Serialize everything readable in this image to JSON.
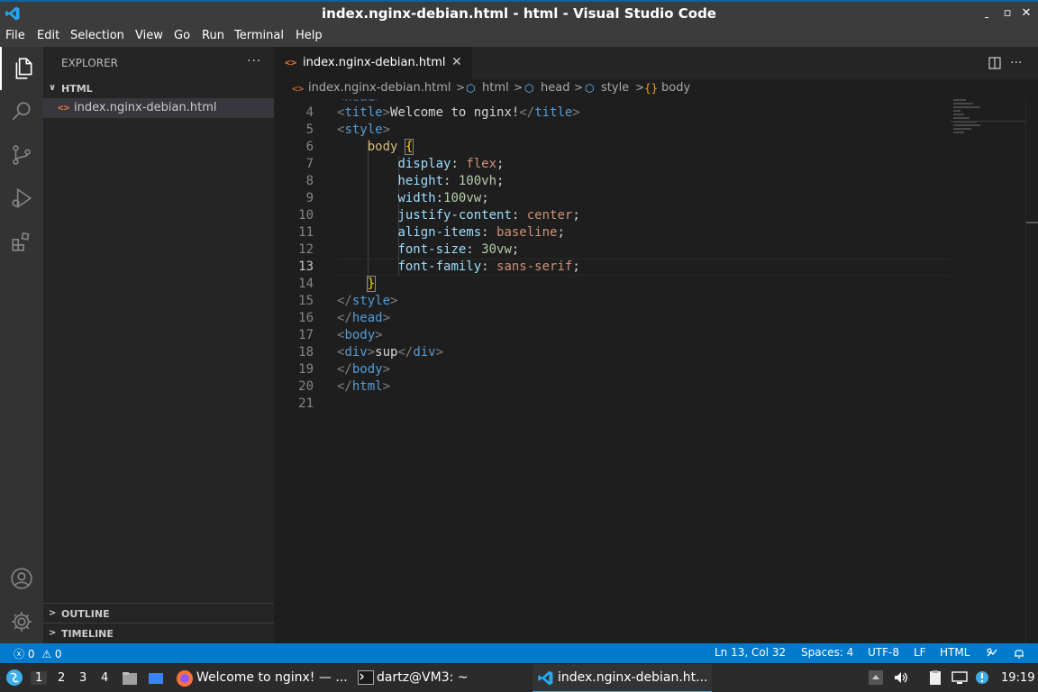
{
  "window": {
    "title": "index.nginx-debian.html - html - Visual Studio Code",
    "controls": {
      "minimize": "ˍ",
      "maximize": "▫",
      "close": "✕"
    }
  },
  "menu": [
    "File",
    "Edit",
    "Selection",
    "View",
    "Go",
    "Run",
    "Terminal",
    "Help"
  ],
  "activity_bar": {
    "top": [
      "explorer-icon",
      "search-icon",
      "source-control-icon",
      "run-debug-icon",
      "extensions-icon"
    ],
    "bottom": [
      "accounts-icon",
      "manage-gear-icon"
    ]
  },
  "sidebar": {
    "title": "EXPLORER",
    "more": "···",
    "folder": {
      "chevron": "∨",
      "label": "HTML"
    },
    "files": [
      {
        "icon": "<>",
        "name": "index.nginx-debian.html"
      }
    ],
    "outline": {
      "chevron": ">",
      "label": "OUTLINE"
    },
    "timeline": {
      "chevron": ">",
      "label": "TIMELINE"
    }
  },
  "tab": {
    "icon": "<>",
    "name": "index.nginx-debian.html",
    "close": "✕"
  },
  "breadcrumbs": [
    {
      "icon": "<>",
      "label": "index.nginx-debian.html"
    },
    {
      "icon": "⬡",
      "label": "html"
    },
    {
      "icon": "⬡",
      "label": "head"
    },
    {
      "icon": "⬡",
      "label": "style"
    },
    {
      "icon": "{}",
      "label": "body"
    }
  ],
  "breadcrumb_sep": ">",
  "code": {
    "current_line": "13",
    "partial_line": "<head>",
    "lines": [
      {
        "n": "4",
        "segs": [
          [
            "t-br",
            "<"
          ],
          [
            "t-tag",
            "title"
          ],
          [
            "t-br",
            ">"
          ],
          [
            "t-txt",
            "Welcome to nginx!"
          ],
          [
            "t-br",
            "</"
          ],
          [
            "t-tag",
            "title"
          ],
          [
            "t-br",
            ">"
          ]
        ]
      },
      {
        "n": "5",
        "segs": [
          [
            "t-br",
            "<"
          ],
          [
            "t-tag",
            "style"
          ],
          [
            "t-br",
            ">"
          ]
        ]
      },
      {
        "n": "6",
        "segs": [
          [
            "t-txt",
            "    "
          ],
          [
            "t-sel",
            "body"
          ],
          [
            "t-txt",
            " "
          ],
          [
            "t-brace brace-box",
            "{"
          ]
        ]
      },
      {
        "n": "7",
        "segs": [
          [
            "t-txt",
            "        "
          ],
          [
            "t-prop",
            "display"
          ],
          [
            "t-txt",
            ": "
          ],
          [
            "t-val",
            "flex"
          ],
          [
            "t-txt",
            ";"
          ]
        ]
      },
      {
        "n": "8",
        "segs": [
          [
            "t-txt",
            "        "
          ],
          [
            "t-prop",
            "height"
          ],
          [
            "t-txt",
            ": "
          ],
          [
            "t-num",
            "100vh"
          ],
          [
            "t-txt",
            ";"
          ]
        ]
      },
      {
        "n": "9",
        "segs": [
          [
            "t-txt",
            "        "
          ],
          [
            "t-prop",
            "width"
          ],
          [
            "t-txt",
            ":"
          ],
          [
            "t-num",
            "100vw"
          ],
          [
            "t-txt",
            ";"
          ]
        ]
      },
      {
        "n": "10",
        "segs": [
          [
            "t-txt",
            "        "
          ],
          [
            "t-prop",
            "justify-content"
          ],
          [
            "t-txt",
            ": "
          ],
          [
            "t-val",
            "center"
          ],
          [
            "t-txt",
            ";"
          ]
        ]
      },
      {
        "n": "11",
        "segs": [
          [
            "t-txt",
            "        "
          ],
          [
            "t-prop",
            "align-items"
          ],
          [
            "t-txt",
            ": "
          ],
          [
            "t-val",
            "baseline"
          ],
          [
            "t-txt",
            ";"
          ]
        ]
      },
      {
        "n": "12",
        "segs": [
          [
            "t-txt",
            "        "
          ],
          [
            "t-prop",
            "font-size"
          ],
          [
            "t-txt",
            ": "
          ],
          [
            "t-num",
            "30vw"
          ],
          [
            "t-txt",
            ";"
          ]
        ]
      },
      {
        "n": "13",
        "segs": [
          [
            "t-txt",
            "        "
          ],
          [
            "t-prop",
            "font-family"
          ],
          [
            "t-txt",
            ": "
          ],
          [
            "t-val",
            "sans-serif"
          ],
          [
            "t-txt",
            ";"
          ]
        ]
      },
      {
        "n": "14",
        "segs": [
          [
            "t-txt",
            "    "
          ],
          [
            "t-brace brace-box",
            "}"
          ]
        ]
      },
      {
        "n": "15",
        "segs": [
          [
            "t-br",
            "</"
          ],
          [
            "t-tag",
            "style"
          ],
          [
            "t-br",
            ">"
          ]
        ]
      },
      {
        "n": "16",
        "segs": [
          [
            "t-br",
            "</"
          ],
          [
            "t-tag",
            "head"
          ],
          [
            "t-br",
            ">"
          ]
        ]
      },
      {
        "n": "17",
        "segs": [
          [
            "t-br",
            "<"
          ],
          [
            "t-tag",
            "body"
          ],
          [
            "t-br",
            ">"
          ]
        ]
      },
      {
        "n": "18",
        "segs": [
          [
            "t-br",
            "<"
          ],
          [
            "t-tag",
            "div"
          ],
          [
            "t-br",
            ">"
          ],
          [
            "t-txt",
            "sup"
          ],
          [
            "t-br",
            "</"
          ],
          [
            "t-tag",
            "div"
          ],
          [
            "t-br",
            ">"
          ]
        ]
      },
      {
        "n": "19",
        "segs": [
          [
            "t-br",
            "</"
          ],
          [
            "t-tag",
            "body"
          ],
          [
            "t-br",
            ">"
          ]
        ]
      },
      {
        "n": "20",
        "segs": [
          [
            "t-br",
            "</"
          ],
          [
            "t-tag",
            "html"
          ],
          [
            "t-br",
            ">"
          ]
        ]
      },
      {
        "n": "21",
        "segs": []
      }
    ]
  },
  "status": {
    "errors": "0",
    "warnings": "0",
    "position": "Ln 13, Col 32",
    "spaces": "Spaces: 4",
    "encoding": "UTF-8",
    "eol": "LF",
    "language": "HTML"
  },
  "taskbar": {
    "workspaces": [
      "1",
      "2",
      "3",
      "4"
    ],
    "tasks": [
      {
        "icon": "firefox-icon",
        "label": "Welcome to nginx! — ..."
      },
      {
        "icon": "terminal-icon",
        "label": "dartz@VM3: ~"
      },
      {
        "icon": "vscode-icon",
        "label": "index.nginx-debian.ht..."
      }
    ],
    "clock": "19:19"
  },
  "colors": {
    "accent": "#007acc",
    "title_bar": "#3c3c3c",
    "editor_bg": "#1e1e1e",
    "sidebar_bg": "#252526",
    "activity_bg": "#333333"
  }
}
